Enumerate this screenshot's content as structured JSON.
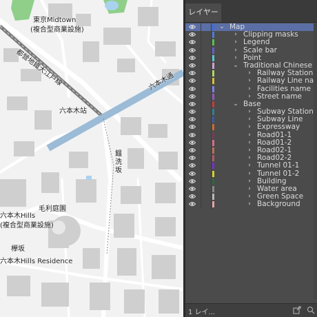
{
  "panel": {
    "tab_label": "レイヤー",
    "footer_label": "1 レイ...",
    "layers": [
      {
        "name": "Map",
        "color": "#3a6fd8",
        "indent": 0,
        "expanded": true
      },
      {
        "name": "Clipping masks",
        "color": "#4c7be0",
        "indent": 1,
        "expanded": false
      },
      {
        "name": "Legend",
        "color": "#56c24a",
        "indent": 1,
        "expanded": false
      },
      {
        "name": "Scale bar",
        "color": "#6a5ad0",
        "indent": 1,
        "expanded": false
      },
      {
        "name": "Point",
        "color": "#58c8d8",
        "indent": 1,
        "expanded": false
      },
      {
        "name": "Traditional Chinese",
        "color": "#cfa0d8",
        "indent": 1,
        "expanded": true
      },
      {
        "name": "Railway Station",
        "color": "#b0d85a",
        "indent": 2,
        "expanded": false
      },
      {
        "name": "Railway Line name",
        "color": "#d8c02e",
        "indent": 2,
        "expanded": false
      },
      {
        "name": "Facilities name",
        "color": "#7a82e8",
        "indent": 2,
        "expanded": false
      },
      {
        "name": "Street name",
        "color": "#9058c0",
        "indent": 2,
        "expanded": false
      },
      {
        "name": "Base",
        "color": "#c43a3a",
        "indent": 1,
        "expanded": true
      },
      {
        "name": "Subway Station",
        "color": "#2f7f9a",
        "indent": 2,
        "expanded": false
      },
      {
        "name": "Subway Line",
        "color": "#3a5aa8",
        "indent": 2,
        "expanded": false
      },
      {
        "name": "Expressway",
        "color": "#d06a2a",
        "indent": 2,
        "expanded": false
      },
      {
        "name": "Road01-1",
        "color": "#7a3a58",
        "indent": 2,
        "expanded": false
      },
      {
        "name": "Road01-2",
        "color": "#d86a8a",
        "indent": 2,
        "expanded": false
      },
      {
        "name": "Road02-1",
        "color": "#c06a58",
        "indent": 2,
        "expanded": false
      },
      {
        "name": "Road02-2",
        "color": "#b05a6a",
        "indent": 2,
        "expanded": false
      },
      {
        "name": "Tunnel 01-1",
        "color": "#7a2ad8",
        "indent": 2,
        "expanded": false
      },
      {
        "name": "Tunnel 01-2",
        "color": "#d8d02a",
        "indent": 2,
        "expanded": false
      },
      {
        "name": "Building",
        "color": "#2a6a3a",
        "indent": 2,
        "expanded": false
      },
      {
        "name": "Water area",
        "color": "#8a8a8a",
        "indent": 2,
        "expanded": false
      },
      {
        "name": "Green Space",
        "color": "#b8b8b8",
        "indent": 2,
        "expanded": false
      },
      {
        "name": "Background",
        "color": "#e8a0a8",
        "indent": 2,
        "expanded": false
      }
    ]
  },
  "map": {
    "labels": {
      "midtown": "東京Midtown",
      "midtown_sub": "(複合型商業設施)",
      "oedo_line": "都營地鐵大江戶線",
      "roppongi_dori": "六本木通",
      "roppongi_station": "六本木站",
      "slope": "饂\n洗\n坂",
      "hills": "六本木Hills",
      "hills_sub": "(複合型商業設施)",
      "mori_garden": "毛利庭園",
      "keyaki": "欅坂",
      "residence": "六本木Hills Residence"
    },
    "colors": {
      "road": "#ffffff",
      "building": "#cfcfcf",
      "ground": "#f2f2f2",
      "green": "#8fcf8a",
      "water": "#a9d2ee",
      "expressway": "#9bbbd6",
      "subway": "#777777"
    }
  }
}
